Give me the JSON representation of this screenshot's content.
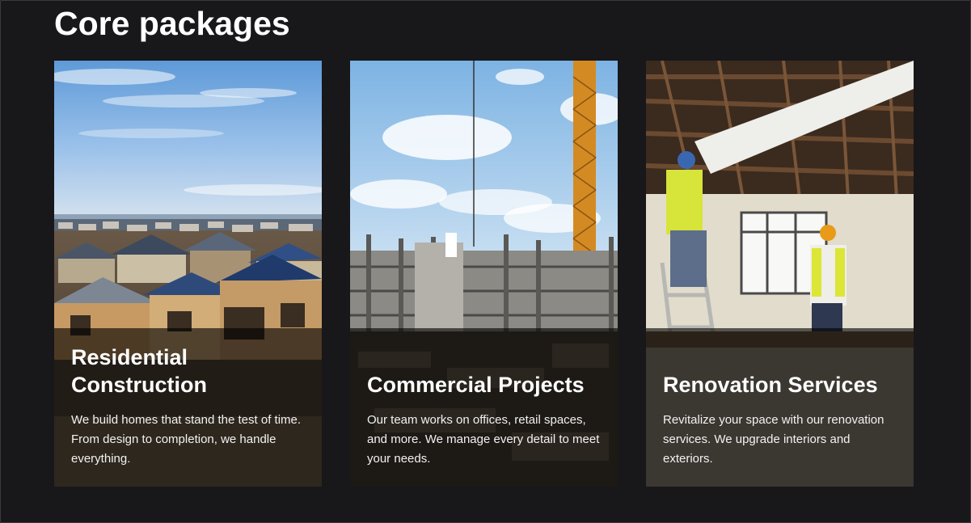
{
  "section": {
    "title": "Core packages"
  },
  "cards": [
    {
      "image": "residential-neighborhood-photo",
      "title": "Residential Construction",
      "description": "We build homes that stand the test of time. From design to completion, we handle everything."
    },
    {
      "image": "commercial-construction-site-photo",
      "title": "Commercial Projects",
      "description": "Our team works on offices, retail spaces, and more. We manage every detail to meet your needs."
    },
    {
      "image": "renovation-workers-photo",
      "title": "Renovation Services",
      "description": "Revitalize your space with our renovation services. We upgrade interiors and exteriors."
    }
  ]
}
